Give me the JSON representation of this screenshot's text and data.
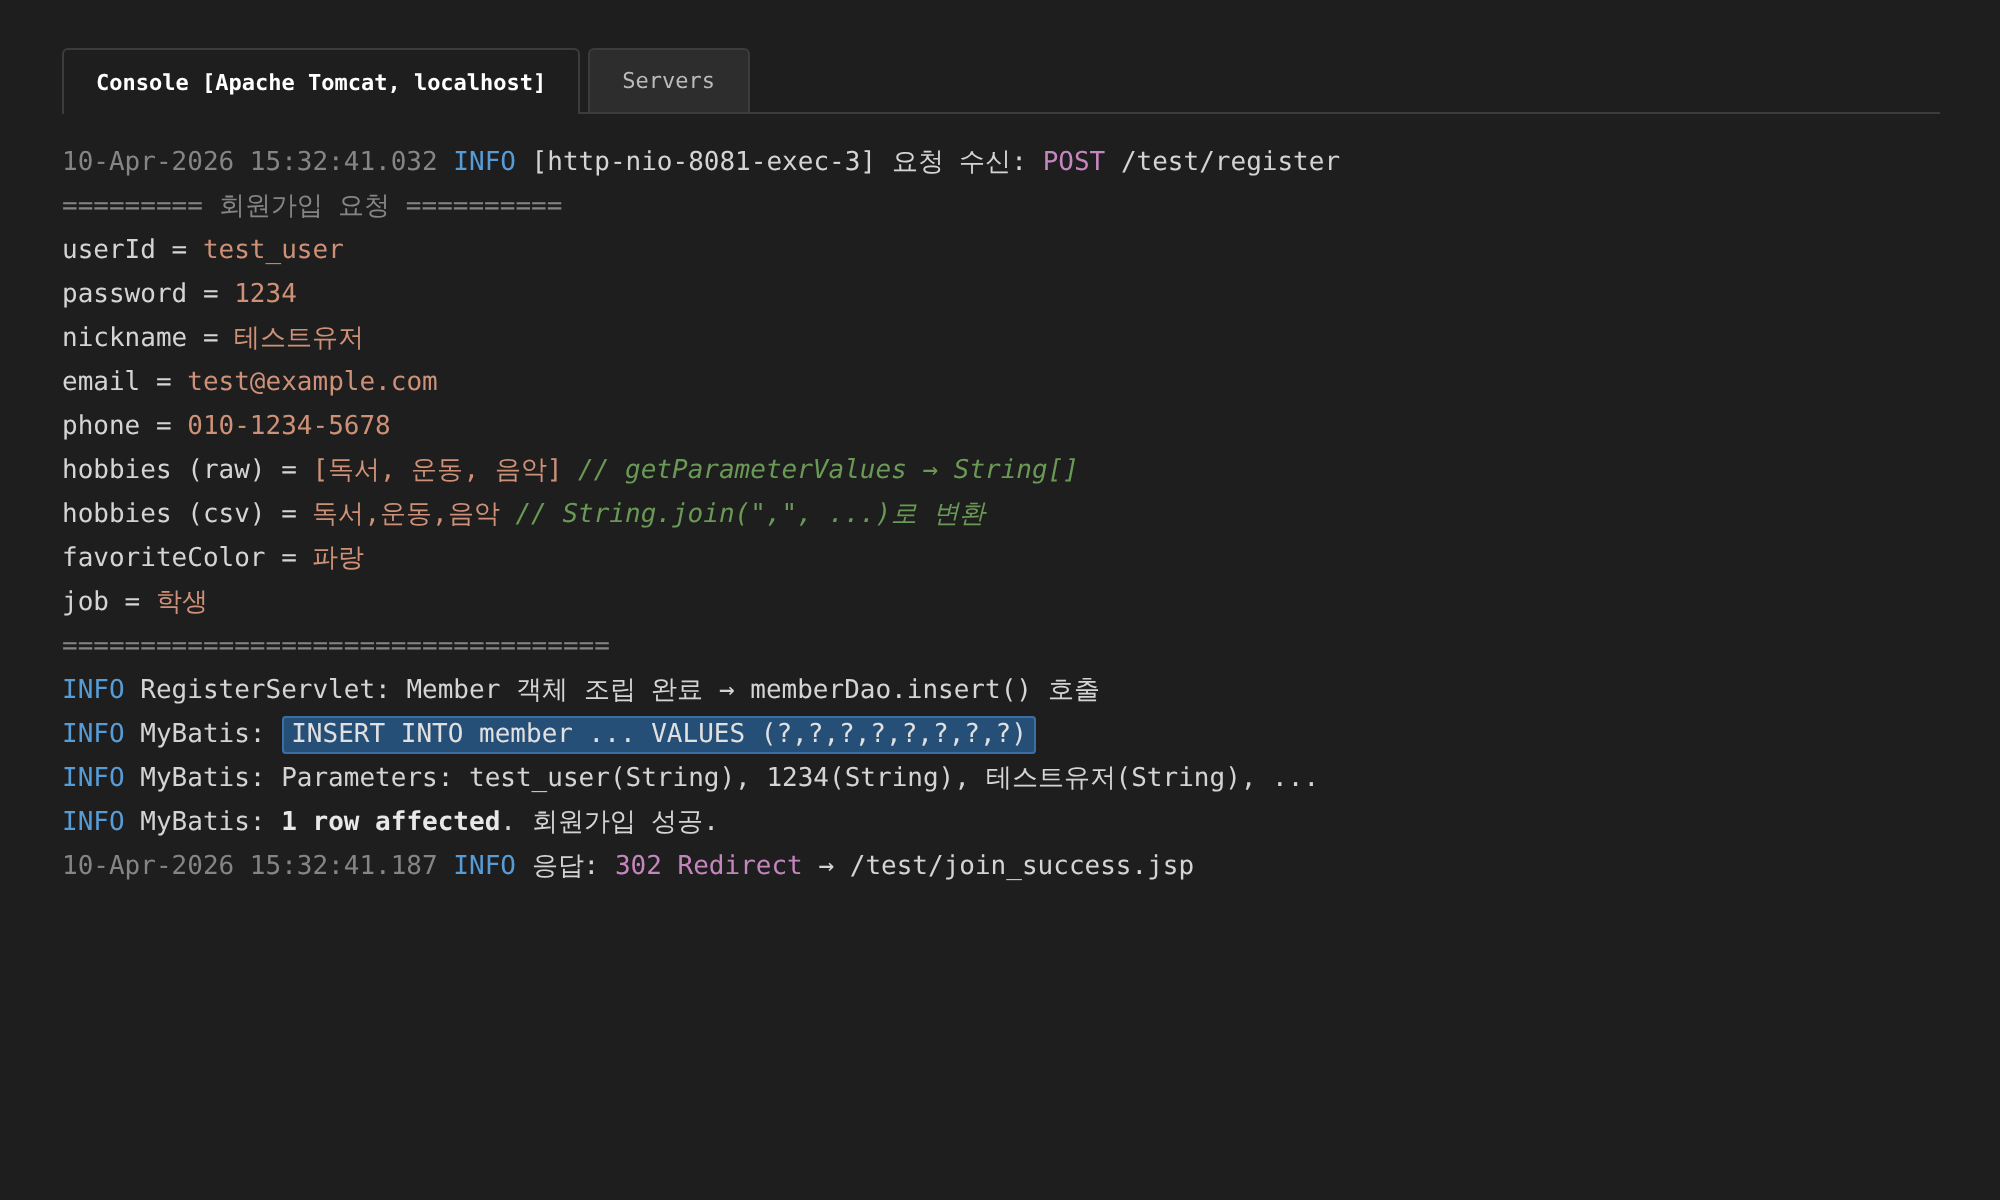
{
  "tabs": [
    {
      "label": "Console [Apache Tomcat, localhost]",
      "selected": true
    },
    {
      "label": "Servers",
      "selected": false
    }
  ],
  "console_lines": [
    [
      {
        "kind": "time",
        "text": "10-Apr-2026 15:32:41.032 "
      },
      {
        "kind": "info",
        "text": "INFO"
      },
      {
        "kind": "text",
        "text": " [http-nio-8081-exec-3] 요청 수신: "
      },
      {
        "kind": "method",
        "text": "POST"
      },
      {
        "kind": "text",
        "text": " /test/register"
      }
    ],
    [
      {
        "kind": "separator",
        "text": "========= 회원가입 요청 =========="
      }
    ],
    [
      {
        "kind": "text",
        "text": "userId = "
      },
      {
        "kind": "value",
        "text": "test_user"
      }
    ],
    [
      {
        "kind": "text",
        "text": "password = "
      },
      {
        "kind": "value",
        "text": "1234"
      }
    ],
    [
      {
        "kind": "text",
        "text": "nickname = "
      },
      {
        "kind": "value",
        "text": "테스트유저"
      }
    ],
    [
      {
        "kind": "text",
        "text": "email = "
      },
      {
        "kind": "value",
        "text": "test@example.com"
      }
    ],
    [
      {
        "kind": "text",
        "text": "phone = "
      },
      {
        "kind": "value",
        "text": "010-1234-5678"
      }
    ],
    [
      {
        "kind": "text",
        "text": "hobbies (raw) = "
      },
      {
        "kind": "value",
        "text": "[독서, 운동, 음악]"
      },
      {
        "kind": "comment",
        "text": " // getParameterValues → String[]"
      }
    ],
    [
      {
        "kind": "text",
        "text": "hobbies (csv) = "
      },
      {
        "kind": "value",
        "text": "독서,운동,음악"
      },
      {
        "kind": "comment",
        "text": " // String.join(\",\", ...)로 변환"
      }
    ],
    [
      {
        "kind": "text",
        "text": "favoriteColor = "
      },
      {
        "kind": "value",
        "text": "파랑"
      }
    ],
    [
      {
        "kind": "text",
        "text": "job = "
      },
      {
        "kind": "value",
        "text": "학생"
      }
    ],
    [
      {
        "kind": "separator",
        "text": "==================================="
      }
    ],
    [
      {
        "kind": "info",
        "text": "INFO"
      },
      {
        "kind": "text",
        "text": " RegisterServlet: Member 객체 조립 완료 → memberDao.insert() 호출"
      }
    ],
    [
      {
        "kind": "info",
        "text": "INFO"
      },
      {
        "kind": "text",
        "text": " MyBatis: "
      },
      {
        "kind": "highlight",
        "text": "INSERT INTO member ... VALUES (?,?,?,?,?,?,?,?)"
      }
    ],
    [
      {
        "kind": "info",
        "text": "INFO"
      },
      {
        "kind": "text",
        "text": " MyBatis: Parameters: test_user(String), 1234(String), 테스트유저(String), ..."
      }
    ],
    [
      {
        "kind": "info",
        "text": "INFO"
      },
      {
        "kind": "text",
        "text": " MyBatis: "
      },
      {
        "kind": "bold",
        "text": "1 row affected"
      },
      {
        "kind": "text",
        "text": ". 회원가입 성공."
      }
    ],
    [
      {
        "kind": "time",
        "text": "10-Apr-2026 15:32:41.187 "
      },
      {
        "kind": "info",
        "text": "INFO"
      },
      {
        "kind": "text",
        "text": " 응답: "
      },
      {
        "kind": "method",
        "text": "302 Redirect"
      },
      {
        "kind": "text",
        "text": " → /test/join_success.jsp"
      }
    ]
  ]
}
